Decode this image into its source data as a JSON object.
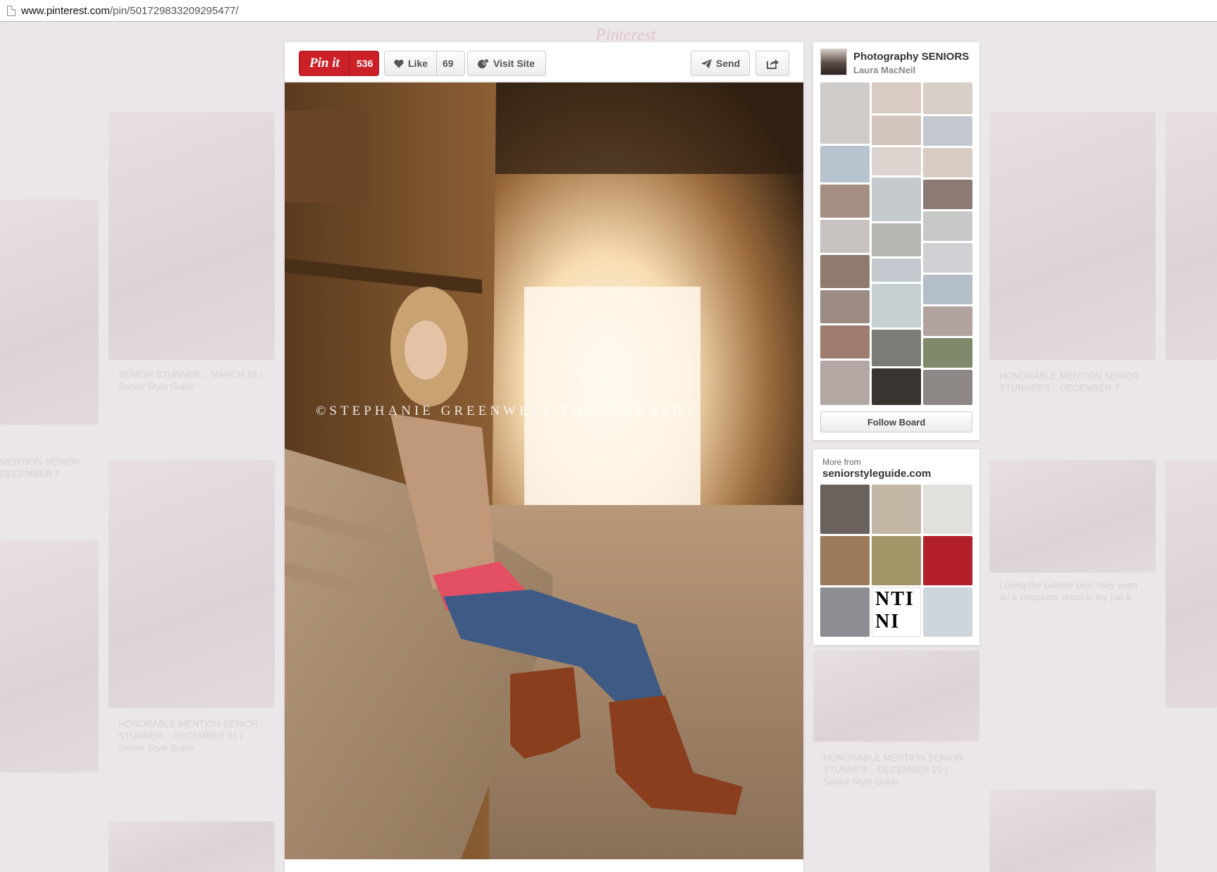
{
  "browser": {
    "url_host": "www.pinterest.com",
    "url_path": "/pin/501729833209295477/"
  },
  "background": {
    "logo": "Pinterest",
    "ghost_texts": [
      "SENIOR STUNNER :: MARCH 18 | Senior Style Guide",
      "HONORABLE MENTION SENIOR STUNNER :: DECEMBER 21 | Senior Style Guide",
      "HONORABLE MENTION SENIOR STUNNERS :: DECEMBER 7",
      "HONORABLE MENTION SENIOR STUNNER :: DECEMBER 21 | Senior Style Guide",
      "MENTION SENIOR DECEMBER 7",
      "Loving the outside pics, may even do a corporate shoot in my hat &"
    ]
  },
  "pin": {
    "pinit_label": "Pin it",
    "pinit_count": "536",
    "like_label": "Like",
    "like_count": "69",
    "visit_label": "Visit Site",
    "send_label": "Send",
    "watermark": "©STEPHANIE GREENWELL PHOTOGRAPHY"
  },
  "board": {
    "title": "Photography SENIORS",
    "owner": "Laura MacNeil",
    "follow_label": "Follow Board"
  },
  "more_from": {
    "label": "More from",
    "domain": "seniorstyleguide.com",
    "mosaic_letters": "NTI NI E G"
  },
  "colors": {
    "pin_red": "#cb2027",
    "overlay": "#ebe6ea"
  }
}
